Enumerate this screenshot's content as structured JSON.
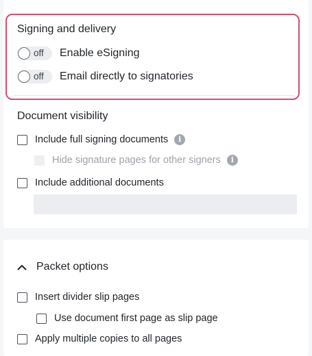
{
  "signing": {
    "title": "Signing and delivery",
    "toggles": [
      {
        "state_text": "off",
        "label": "Enable eSigning",
        "on": false
      },
      {
        "state_text": "off",
        "label": "Email directly to signatories",
        "on": false
      }
    ]
  },
  "visibility": {
    "title": "Document visibility",
    "full_docs_label": "Include full signing documents",
    "hide_sig_label": "Hide signature pages for other signers",
    "additional_docs_label": "Include additional documents",
    "additional_docs_value": ""
  },
  "packet": {
    "title": "Packet options",
    "divider_label": "Insert divider slip pages",
    "first_page_label": "Use document first page as slip page",
    "copies_label": "Apply multiple copies to all pages"
  },
  "icons": {
    "info": "info-icon",
    "chevron": "chevron-up-icon"
  },
  "colors": {
    "highlight": "#d94a6b",
    "toggle_bg": "#ebedf0"
  }
}
